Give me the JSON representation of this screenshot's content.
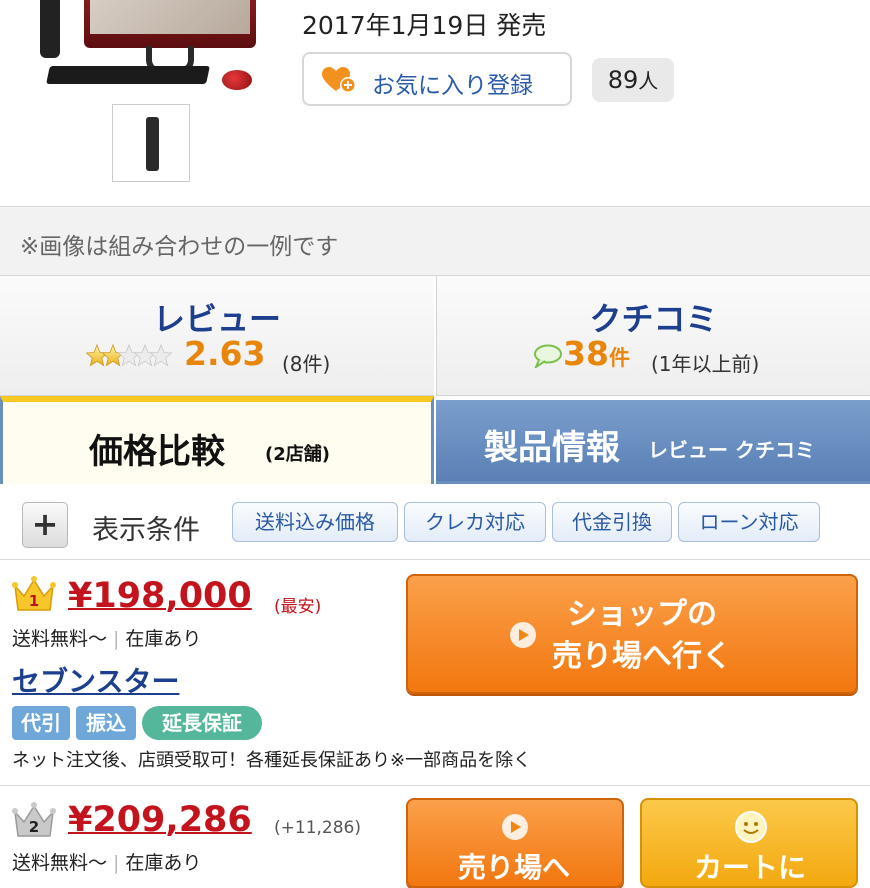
{
  "product": {
    "release_date": "2017年1月19日 発売",
    "favorite_label": "お気に入り登録",
    "favorite_count": "89",
    "favorite_unit": "人"
  },
  "note": "※画像は組み合わせの一例です",
  "ratings": {
    "review_title": "レビュー",
    "review_score": "2.63",
    "review_count": "(8件)",
    "review_stars": 2.63,
    "kuchikomi_title": "クチコミ",
    "kuchikomi_count": "38",
    "kuchikomi_unit": "件",
    "kuchikomi_age": "(1年以上前)"
  },
  "tabs": {
    "price_label": "価格比較",
    "price_sub": "(2店舗)",
    "info_label": "製品情報",
    "info_sub": "レビュー クチコミ"
  },
  "filters": {
    "label": "表示条件",
    "chips": [
      "送料込み価格",
      "クレカ対応",
      "代金引換",
      "ローン対応"
    ]
  },
  "shops": [
    {
      "rank": "1",
      "price": "¥198,000",
      "price_note": "(最安)",
      "shipping": "送料無料〜",
      "stock": "在庫あり",
      "name": "セブンスター",
      "badges": [
        "代引",
        "振込",
        "延長保証"
      ],
      "description": "ネット注文後、店頭受取可！各種延長保証あり※一部商品を除く",
      "button_line1": "ショップの",
      "button_line2": "売り場へ行く"
    },
    {
      "rank": "2",
      "price": "¥209,286",
      "price_note": "(+11,286)",
      "shipping": "送料無料〜",
      "stock": "在庫あり",
      "button_store": "売り場へ",
      "button_cart": "カートに"
    }
  ],
  "colors": {
    "link_blue": "#1e3f8e",
    "price_red": "#c3131c",
    "accent_orange": "#f2770f",
    "score_orange": "#e8860c"
  }
}
